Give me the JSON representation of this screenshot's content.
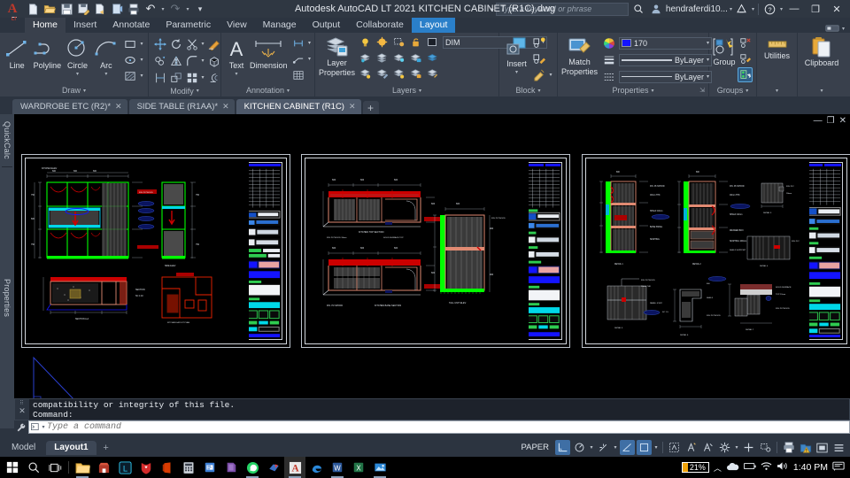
{
  "window": {
    "title": "Autodesk AutoCAD LT 2021    KITCHEN CABINET (R1C).dwg",
    "minimize": "—",
    "restore": "❐",
    "close": "✕"
  },
  "quick_access": [
    {
      "name": "new-icon",
      "glyph": "🗋"
    },
    {
      "name": "open-icon",
      "glyph": "🗁"
    },
    {
      "name": "save-icon",
      "glyph": "🖫"
    },
    {
      "name": "saveas-icon",
      "glyph": "🖫"
    },
    {
      "name": "export-icon",
      "glyph": "🖨"
    },
    {
      "name": "plot-preview-icon",
      "glyph": "🗐"
    },
    {
      "name": "plot-icon",
      "glyph": "🖶"
    },
    {
      "name": "undo-icon",
      "glyph": "↶"
    },
    {
      "name": "redo-icon",
      "glyph": "↷"
    },
    {
      "name": "customize-qat-icon",
      "glyph": "▾"
    }
  ],
  "search": {
    "placeholder": "Type a keyword or phrase",
    "icon": "search-icon"
  },
  "account": {
    "name": "hendraferdi10...",
    "icon": "user-icon"
  },
  "titlebar_extras": [
    {
      "name": "autodesk-app-icon",
      "glyph": "A"
    },
    {
      "name": "help-icon",
      "glyph": "?"
    }
  ],
  "ribbon_tabs": [
    {
      "label": "Home",
      "state": "active"
    },
    {
      "label": "Insert",
      "state": "normal"
    },
    {
      "label": "Annotate",
      "state": "normal"
    },
    {
      "label": "Parametric",
      "state": "normal"
    },
    {
      "label": "View",
      "state": "normal"
    },
    {
      "label": "Manage",
      "state": "normal"
    },
    {
      "label": "Output",
      "state": "normal"
    },
    {
      "label": "Collaborate",
      "state": "normal"
    },
    {
      "label": "Layout",
      "state": "highlight"
    }
  ],
  "panels": {
    "draw": {
      "title": "Draw",
      "tools": [
        {
          "label": "Line",
          "name": "line-tool"
        },
        {
          "label": "Polyline",
          "name": "polyline-tool"
        },
        {
          "label": "Circle",
          "name": "circle-tool"
        },
        {
          "label": "Arc",
          "name": "arc-tool"
        }
      ],
      "small": [
        {
          "name": "rectangle-tool"
        },
        {
          "name": "ellipse-tool"
        },
        {
          "name": "hatch-tool"
        }
      ]
    },
    "modify": {
      "title": "Modify",
      "small": [
        {
          "name": "move-tool"
        },
        {
          "name": "rotate-tool"
        },
        {
          "name": "trim-tool"
        },
        {
          "name": "erase-tool"
        },
        {
          "name": "copy-tool"
        },
        {
          "name": "mirror-tool"
        },
        {
          "name": "fillet-tool"
        },
        {
          "name": "explode-tool"
        },
        {
          "name": "stretch-tool"
        },
        {
          "name": "scale-tool"
        },
        {
          "name": "array-tool"
        },
        {
          "name": "offset-tool"
        }
      ]
    },
    "annotation": {
      "title": "Annotation",
      "tools": [
        {
          "label": "Text",
          "name": "text-tool"
        },
        {
          "label": "Dimension",
          "name": "dimension-tool"
        }
      ],
      "small": [
        {
          "name": "dimension-style-tool"
        },
        {
          "name": "leader-tool"
        },
        {
          "name": "table-tool"
        }
      ]
    },
    "layers": {
      "title": "Layers",
      "main": "Layer\nProperties",
      "main_line1": "Layer",
      "main_line2": "Properties",
      "layer_name": "DIM",
      "small": [
        {
          "name": "layer-on-off-icon"
        },
        {
          "name": "layer-freeze-icon"
        },
        {
          "name": "layer-isolate-icon"
        },
        {
          "name": "layer-lock-icon"
        },
        {
          "name": "layer-match-icon"
        },
        {
          "name": "layer-previous-icon"
        },
        {
          "name": "layer-unisolate-icon"
        },
        {
          "name": "layer-unlock-icon"
        },
        {
          "name": "layer-merge-icon"
        },
        {
          "name": "layer-change-icon"
        },
        {
          "name": "layer-walk-icon"
        },
        {
          "name": "layer-turn-all-on-icon"
        },
        {
          "name": "layer-unlock-all-icon"
        },
        {
          "name": "layer-delete-icon"
        }
      ]
    },
    "block": {
      "title": "Block",
      "main_line1": "Insert",
      "small": [
        {
          "name": "block-editor-icon"
        },
        {
          "name": "edit-attribute-icon"
        },
        {
          "name": "define-attributes-icon"
        }
      ]
    },
    "properties": {
      "title": "Properties",
      "main_line1": "Match",
      "main_line2": "Properties",
      "color": {
        "label": "170",
        "hex": "#1414ff"
      },
      "linewidth": {
        "label": "ByLayer"
      },
      "linetype": {
        "label": "ByLayer"
      },
      "color_wheel": "color-wheel-icon",
      "dialog_launcher": "properties-dialog-launcher-icon"
    },
    "groups": {
      "title": "Groups",
      "main_line1": "Group",
      "small": [
        {
          "name": "ungroup-icon"
        },
        {
          "name": "group-edit-icon"
        },
        {
          "name": "group-selection-on-off-icon"
        }
      ]
    },
    "utilities": {
      "title": "Utilities",
      "label": "Utilities",
      "icon": "measure-ruler-icon"
    },
    "clipboard": {
      "title": "Clipboard",
      "label": "Clipboard",
      "icon": "clipboard-icon"
    }
  },
  "document_tabs": [
    {
      "label": "WARDROBE ETC (R2)*",
      "active": false,
      "close": "✕"
    },
    {
      "label": "SIDE TABLE (R1AA)*",
      "active": false,
      "close": "✕"
    },
    {
      "label": "KITCHEN CABINET (R1C)",
      "active": true,
      "close": "✕"
    },
    {
      "label": "+",
      "active": false,
      "is_add": true
    }
  ],
  "left_rail": [
    {
      "label": "QuickCalc",
      "name": "palette-quickcalc"
    },
    {
      "label": "Properties",
      "name": "palette-properties"
    }
  ],
  "drawing": {
    "viewport_buttons": {
      "minimize": "—",
      "restore": "❐",
      "close": "✕"
    },
    "sheets": [
      {
        "name": "sheet-kitchen-cabinet-elevation"
      },
      {
        "name": "sheet-kitchen-cabinet-sections"
      },
      {
        "name": "sheet-kitchen-cabinet-details"
      }
    ]
  },
  "command_line": {
    "history": [
      "compatibility or integrity of this file.",
      "Command:"
    ],
    "input_value": "",
    "placeholder": "Type a command",
    "close_icon": "✕",
    "tools_icon": "wrench-icon",
    "prompt_icon": "command-prompt-icon"
  },
  "layout_tabs": [
    {
      "label": "Model",
      "active": false
    },
    {
      "label": "Layout1",
      "active": true
    }
  ],
  "layout_add": "+",
  "status_bar": {
    "paper_label": "PAPER",
    "buttons": [
      {
        "name": "ortho-mode-toggle",
        "on": true
      },
      {
        "name": "polar-tracking-toggle",
        "on": false
      },
      {
        "name": "object-snap-tracking-toggle",
        "on": false
      },
      {
        "name": "object-snap-toggle",
        "on": true
      },
      {
        "name": "ortho-rect-toggle",
        "on": true
      },
      {
        "name": "annotation-visibility-toggle",
        "on": false
      },
      {
        "name": "annotation-scale-auto-toggle",
        "on": false
      },
      {
        "name": "annotation-scale-add-toggle",
        "on": false
      },
      {
        "name": "workspace-switching-icon",
        "on": false
      },
      {
        "name": "customization-icon",
        "on": false
      },
      {
        "name": "isolate-objects-icon",
        "on": false
      },
      {
        "name": "plot-status-icon",
        "on": false
      },
      {
        "name": "clean-screen-icon",
        "on": false
      },
      {
        "name": "status-menu-icon",
        "on": false
      }
    ]
  },
  "taskbar": {
    "start": {
      "name": "start-button",
      "glyph": "⊞"
    },
    "search": {
      "name": "taskbar-search-icon",
      "glyph": "🔍"
    },
    "taskview": {
      "name": "task-view-icon",
      "glyph": "❐"
    },
    "apps": [
      {
        "name": "file-explorer-icon",
        "color": "#f7c35f",
        "running": true
      },
      {
        "name": "microsoft-store-icon",
        "color": "#b33a2a",
        "running": false
      },
      {
        "name": "line-app-icon",
        "color": "#2ec7f0",
        "running": false
      },
      {
        "name": "opera-gx-icon",
        "color": "#d42b2b",
        "running": false
      },
      {
        "name": "office-icon",
        "color": "#d83b01",
        "running": false
      },
      {
        "name": "calculator-icon",
        "color": "#d8dde3",
        "running": false
      },
      {
        "name": "powerpoint-icon",
        "color": "#3c7fd4",
        "running": false
      },
      {
        "name": "onenote-icon",
        "color": "#7a4ca6",
        "running": false
      },
      {
        "name": "whatsapp-icon",
        "color": "#25d366",
        "running": true
      },
      {
        "name": "sketchup-icon",
        "color": "#3b6fc4",
        "running": false
      },
      {
        "name": "autocad-icon",
        "color": "#c0392b",
        "running": true,
        "active": true
      },
      {
        "name": "edge-icon",
        "color": "#2b88d8",
        "running": false
      },
      {
        "name": "word-icon",
        "color": "#2b579a",
        "running": true
      },
      {
        "name": "excel-icon",
        "color": "#217346",
        "running": false
      },
      {
        "name": "photos-icon",
        "color": "#2b88d8",
        "running": true
      }
    ],
    "tray": {
      "battery": {
        "percent": "21%",
        "name": "battery-indicator"
      },
      "icons": [
        {
          "name": "show-hidden-icons-chevron",
          "glyph": "︿"
        },
        {
          "name": "onedrive-icon",
          "glyph": "☁"
        },
        {
          "name": "battery-icon",
          "glyph": "▭"
        },
        {
          "name": "wifi-icon",
          "glyph": "📶"
        },
        {
          "name": "volume-icon",
          "glyph": "🔊"
        }
      ],
      "clock": "1:40 PM",
      "notifications": {
        "name": "action-center-icon",
        "glyph": "🗨"
      }
    }
  }
}
